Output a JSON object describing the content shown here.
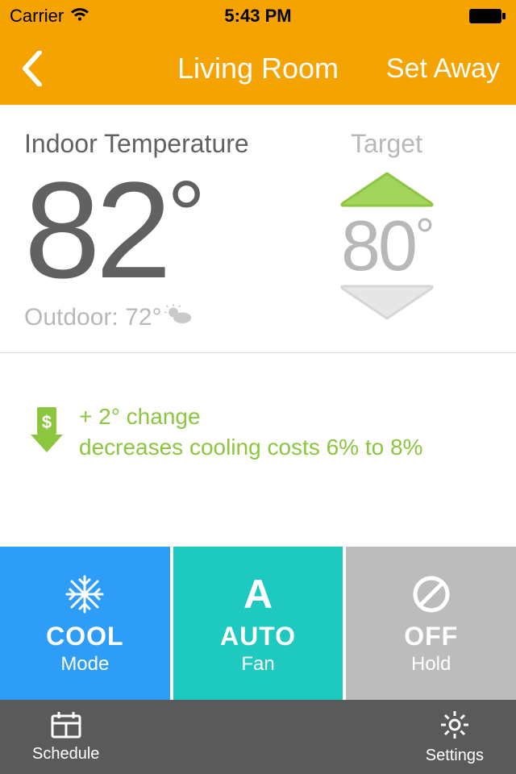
{
  "status": {
    "carrier": "Carrier",
    "time": "5:43 PM"
  },
  "nav": {
    "title": "Living Room",
    "right": "Set Away"
  },
  "temp": {
    "indoor_label": "Indoor Temperature",
    "indoor_value": "82",
    "target_label": "Target",
    "target_value": "80",
    "outdoor_label": "Outdoor: 72°"
  },
  "tip": {
    "line1": "+ 2° change",
    "line2": "decreases cooling costs 6% to 8%"
  },
  "modes": {
    "cool": {
      "big": "COOL",
      "sub": "Mode"
    },
    "auto": {
      "letter": "A",
      "big": "AUTO",
      "sub": "Fan"
    },
    "off": {
      "big": "OFF",
      "sub": "Hold"
    }
  },
  "tabs": {
    "schedule": "Schedule",
    "settings": "Settings"
  }
}
